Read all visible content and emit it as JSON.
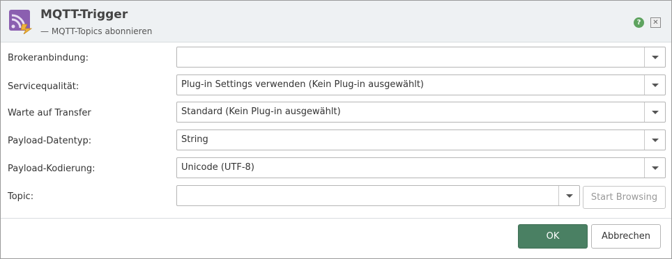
{
  "dialog": {
    "title": "MQTT-Trigger",
    "subtitle": "— MQTT-Topics abonnieren",
    "icon": "mqtt-broadcast-icon",
    "help_glyph": "?",
    "close_glyph": "✕",
    "accent_color": "#4a8063"
  },
  "form": {
    "fields": [
      {
        "label": "Brokeranbindung:",
        "value": ""
      },
      {
        "label": "Servicequalität:",
        "value": "Plug-in Settings verwenden (Kein Plug-in ausgewählt)"
      },
      {
        "label": "Warte auf Transfer",
        "value": "Standard (Kein Plug-in ausgewählt)"
      },
      {
        "label": "Payload-Datentyp:",
        "value": "String"
      },
      {
        "label": "Payload-Kodierung:",
        "value": "Unicode (UTF-8)"
      },
      {
        "label": "Topic:",
        "value": ""
      }
    ],
    "browse_label": "Start Browsing"
  },
  "footer": {
    "ok_label": "OK",
    "cancel_label": "Abbrechen"
  }
}
